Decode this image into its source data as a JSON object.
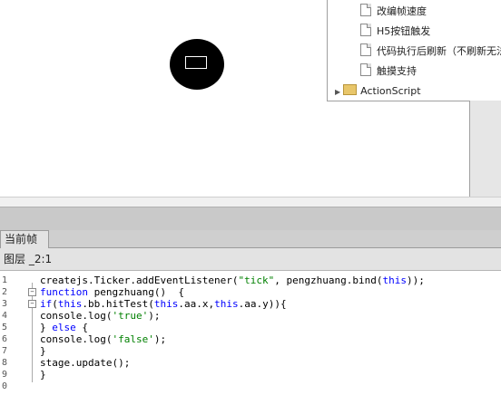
{
  "colors": {
    "keyword": "#0000ff",
    "string": "#008000",
    "sprite_fill": "#000000"
  },
  "library_tree": {
    "items": [
      {
        "label": "改编帧速度",
        "icon": "document-icon"
      },
      {
        "label": "H5按钮触发",
        "icon": "document-icon"
      },
      {
        "label": "代码执行后刷新（不刷新无法",
        "icon": "document-icon"
      },
      {
        "label": "触摸支持",
        "icon": "document-icon"
      }
    ],
    "folder": {
      "label": "ActionScript",
      "icon": "folder-icon"
    }
  },
  "actions_panel": {
    "tab_label": "当前帧",
    "breadcrumb": "图层 _2:1"
  },
  "code_editor": {
    "line_numbers": [
      "1",
      "2",
      "3",
      "4",
      "5",
      "6",
      "7",
      "8",
      "9",
      "0"
    ],
    "lines": [
      [
        {
          "t": "createjs.Ticker.addEventListener(",
          "c": ""
        },
        {
          "t": "\"tick\"",
          "c": "str"
        },
        {
          "t": ", pengzhuang.bind(",
          "c": ""
        },
        {
          "t": "this",
          "c": "kw"
        },
        {
          "t": "));",
          "c": ""
        }
      ],
      [
        {
          "t": "function",
          "c": "kw"
        },
        {
          "t": " pengzhuang()  {",
          "c": ""
        }
      ],
      [
        {
          "t": "if",
          "c": "kw"
        },
        {
          "t": "(",
          "c": ""
        },
        {
          "t": "this",
          "c": "kw"
        },
        {
          "t": ".bb.hitTest(",
          "c": ""
        },
        {
          "t": "this",
          "c": "kw"
        },
        {
          "t": ".aa.x,",
          "c": ""
        },
        {
          "t": "this",
          "c": "kw"
        },
        {
          "t": ".aa.y)){",
          "c": ""
        }
      ],
      [
        {
          "t": "console.log(",
          "c": ""
        },
        {
          "t": "'true'",
          "c": "str"
        },
        {
          "t": ");",
          "c": ""
        }
      ],
      [
        {
          "t": "} ",
          "c": ""
        },
        {
          "t": "else",
          "c": "kw"
        },
        {
          "t": " {",
          "c": ""
        }
      ],
      [
        {
          "t": "console.log(",
          "c": ""
        },
        {
          "t": "'false'",
          "c": "str"
        },
        {
          "t": ");",
          "c": ""
        }
      ],
      [
        {
          "t": "}",
          "c": ""
        }
      ],
      [
        {
          "t": "stage.update();",
          "c": ""
        }
      ],
      [
        {
          "t": "}",
          "c": ""
        }
      ],
      []
    ]
  }
}
